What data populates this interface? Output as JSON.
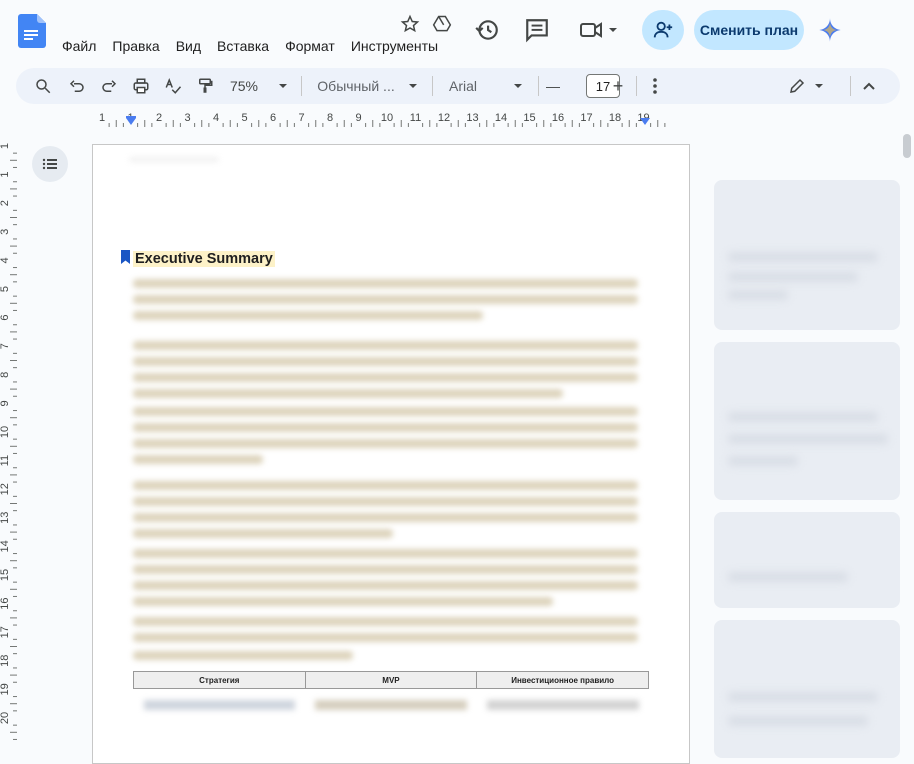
{
  "menu": [
    "Файл",
    "Правка",
    "Вид",
    "Вставка",
    "Формат",
    "Инструменты"
  ],
  "header": {
    "plan_button": "Сменить план",
    "icons": [
      "star-icon",
      "drive-status-icon",
      "history-icon",
      "comment-icon",
      "meet-icon",
      "share-icon",
      "gemini-icon"
    ]
  },
  "toolbar": {
    "zoom": "75%",
    "style": "Обычный ...",
    "font": "Arial",
    "font_size": "17",
    "minus": "—",
    "plus": "+"
  },
  "ruler": {
    "ticks": [
      "1",
      "1",
      "2",
      "3",
      "4",
      "5",
      "6",
      "7",
      "8",
      "9",
      "10",
      "11",
      "12",
      "13",
      "14",
      "15",
      "16",
      "17",
      "18",
      "19"
    ],
    "vticks": [
      "1",
      "1",
      "2",
      "3",
      "4",
      "5",
      "6",
      "7",
      "8",
      "9",
      "10",
      "11",
      "12",
      "13",
      "14",
      "15",
      "16",
      "17",
      "18",
      "19",
      "20"
    ]
  },
  "document": {
    "heading": "Executive Summary",
    "table_headers": [
      "Стратегия",
      "MVP",
      "Инвестиционное правило"
    ]
  },
  "colors": {
    "accent": "#c2e7ff",
    "toolbar_bg": "#edf2fa",
    "bookmark": "#1a56c4",
    "heading_highlight": "#fdf2c8"
  }
}
